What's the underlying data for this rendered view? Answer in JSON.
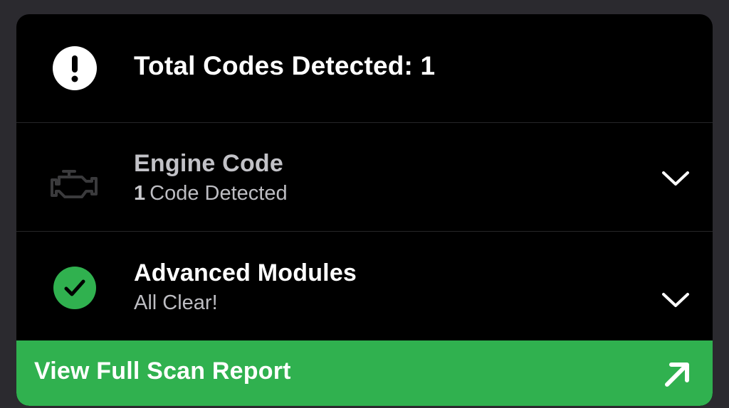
{
  "summary": {
    "total_label": "Total Codes Detected: 1",
    "icon": "exclamation-icon"
  },
  "engine": {
    "title": "Engine Code",
    "count": "1",
    "subtitle": "Code Detected",
    "icon": "engine-icon"
  },
  "advanced": {
    "title": "Advanced Modules",
    "subtitle": "All Clear!",
    "icon": "check-circle-icon"
  },
  "cta": {
    "label": "View Full Scan Report",
    "icon": "arrow-up-right-icon"
  },
  "colors": {
    "background": "#2b2a2f",
    "card": "#000000",
    "accent_green": "#30b14f",
    "text_primary": "#ffffff",
    "text_secondary": "#bdbdc2"
  }
}
